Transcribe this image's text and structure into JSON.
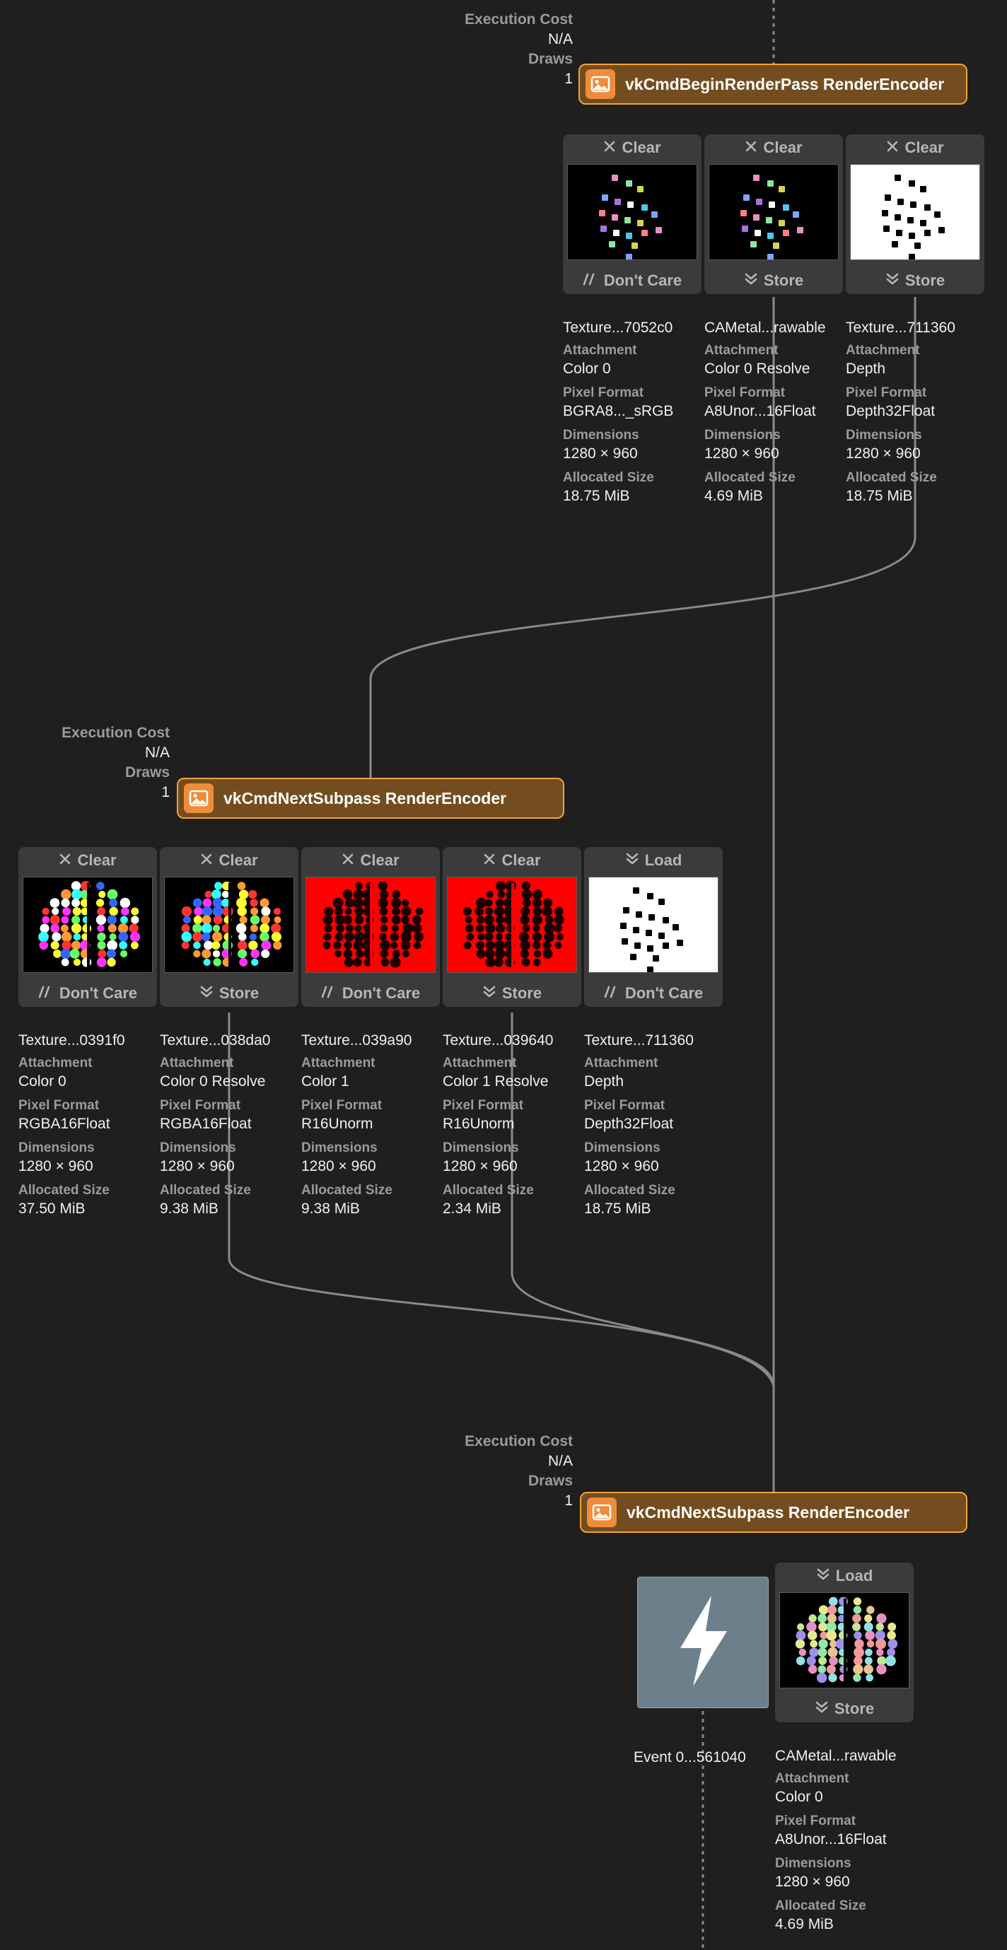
{
  "ops": {
    "clear": "Clear",
    "load": "Load",
    "store": "Store",
    "dont_care": "Don't Care"
  },
  "labels": {
    "execution_cost": "Execution Cost",
    "draws": "Draws",
    "attachment": "Attachment",
    "pixel_format": "Pixel Format",
    "dimensions": "Dimensions",
    "allocated_size": "Allocated Size"
  },
  "encoders": [
    {
      "title": "vkCmdBeginRenderPass RenderEncoder",
      "execution_cost": "N/A",
      "draws": "1",
      "icon": "image-icon",
      "attachments": [
        {
          "load": "Clear",
          "store": "Don't Care",
          "name": "Texture...7052c0",
          "attachment": "Color 0",
          "pixel_format": "BGRA8..._sRGB",
          "dimensions": "1280 × 960",
          "allocated_size": "18.75 MiB",
          "thumb": "sparse-color"
        },
        {
          "load": "Clear",
          "store": "Store",
          "name": "CAMetal...rawable",
          "attachment": "Color 0 Resolve",
          "pixel_format": "A8Unor...16Float",
          "dimensions": "1280 × 960",
          "allocated_size": "4.69 MiB",
          "thumb": "sparse-color"
        },
        {
          "load": "Clear",
          "store": "Store",
          "name": "Texture...711360",
          "attachment": "Depth",
          "pixel_format": "Depth32Float",
          "dimensions": "1280 × 960",
          "allocated_size": "18.75 MiB",
          "thumb": "sparse-depth"
        }
      ]
    },
    {
      "title": "vkCmdNextSubpass RenderEncoder",
      "execution_cost": "N/A",
      "draws": "1",
      "icon": "image-icon",
      "attachments": [
        {
          "load": "Clear",
          "store": "Don't Care",
          "name": "Texture...0391f0",
          "attachment": "Color 0",
          "pixel_format": "RGBA16Float",
          "dimensions": "1280 × 960",
          "allocated_size": "37.50 MiB",
          "thumb": "dense-color"
        },
        {
          "load": "Clear",
          "store": "Store",
          "name": "Texture...038da0",
          "attachment": "Color 0 Resolve",
          "pixel_format": "RGBA16Float",
          "dimensions": "1280 × 960",
          "allocated_size": "9.38 MiB",
          "thumb": "dense-color"
        },
        {
          "load": "Clear",
          "store": "Don't Care",
          "name": "Texture...039a90",
          "attachment": "Color 1",
          "pixel_format": "R16Unorm",
          "dimensions": "1280 × 960",
          "allocated_size": "9.38 MiB",
          "thumb": "red"
        },
        {
          "load": "Clear",
          "store": "Store",
          "name": "Texture...039640",
          "attachment": "Color 1 Resolve",
          "pixel_format": "R16Unorm",
          "dimensions": "1280 × 960",
          "allocated_size": "2.34 MiB",
          "thumb": "red"
        },
        {
          "load": "Load",
          "store": "Don't Care",
          "name": "Texture...711360",
          "attachment": "Depth",
          "pixel_format": "Depth32Float",
          "dimensions": "1280 × 960",
          "allocated_size": "18.75 MiB",
          "thumb": "sparse-depth"
        }
      ]
    },
    {
      "title": "vkCmdNextSubpass RenderEncoder",
      "execution_cost": "N/A",
      "draws": "1",
      "icon": "image-icon",
      "event": {
        "name": "Event 0...561040",
        "icon": "lightning-icon"
      },
      "attachments": [
        {
          "load": "Load",
          "store": "Store",
          "name": "CAMetal...rawable",
          "attachment": "Color 0",
          "pixel_format": "A8Unor...16Float",
          "dimensions": "1280 × 960",
          "allocated_size": "4.69 MiB",
          "thumb": "pastel-color"
        }
      ]
    }
  ],
  "colors": {
    "background": "#1f1f1f",
    "encoder_fill": "#734d1f",
    "encoder_border": "#f5a23a",
    "encoder_icon": "#ef8c3a",
    "wire": "#8a8a8a",
    "event_fill": "#6e7f8c"
  }
}
